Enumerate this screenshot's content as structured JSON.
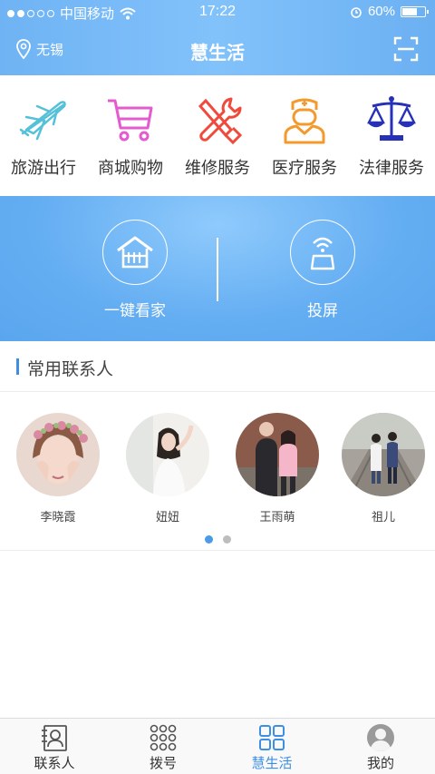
{
  "status_bar": {
    "carrier": "中国移动",
    "time": "17:22",
    "battery": "60%",
    "battery_level": 0.6
  },
  "nav": {
    "location": "无锡",
    "title": "慧生活",
    "scan_icon": "scan-icon"
  },
  "services": [
    {
      "label": "旅游出行",
      "icon": "airplane-icon",
      "color": "#55c1d9"
    },
    {
      "label": "商城购物",
      "icon": "cart-icon",
      "color": "#e45bd0"
    },
    {
      "label": "维修服务",
      "icon": "tools-icon",
      "color": "#ef4a3c"
    },
    {
      "label": "医疗服务",
      "icon": "doctor-icon",
      "color": "#f39a2c"
    },
    {
      "label": "法律服务",
      "icon": "scale-icon",
      "color": "#2631b8"
    }
  ],
  "banner": {
    "home_label": "一键看家",
    "screen_label": "投屏"
  },
  "contacts_section": {
    "title": "常用联系人",
    "contacts": [
      {
        "name": "李晓霞"
      },
      {
        "name": "妞妞"
      },
      {
        "name": "王雨萌"
      },
      {
        "name": "祖儿"
      }
    ],
    "page_index": 1,
    "page_count": 2
  },
  "tabbar": {
    "tabs": [
      {
        "label": "联系人",
        "icon": "contacts-icon"
      },
      {
        "label": "拨号",
        "icon": "dialpad-icon"
      },
      {
        "label": "慧生活",
        "icon": "grid-icon",
        "active": true
      },
      {
        "label": "我的",
        "icon": "profile-icon"
      }
    ]
  },
  "colors": {
    "accent": "#3d8fe3",
    "header": "#6fb3f4"
  }
}
